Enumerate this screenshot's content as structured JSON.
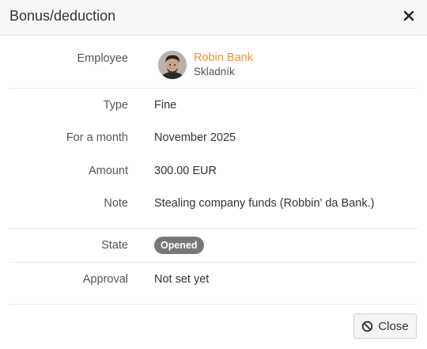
{
  "dialog": {
    "title": "Bonus/deduction",
    "close_icon": "close-icon"
  },
  "employee": {
    "label": "Employee",
    "name": "Robin Bank",
    "role": "Skladník",
    "avatar_icon": "avatar"
  },
  "fields": {
    "type": {
      "label": "Type",
      "value": "Fine"
    },
    "month": {
      "label": "For a month",
      "value": "November 2025"
    },
    "amount": {
      "label": "Amount",
      "value": "300.00 EUR"
    },
    "note": {
      "label": "Note",
      "value": "Stealing company funds (Robbin' da Bank.)"
    }
  },
  "state": {
    "label": "State",
    "badge": "Opened",
    "badge_color": "#777777"
  },
  "approval": {
    "label": "Approval",
    "value": "Not set yet"
  },
  "footer": {
    "close_label": "Close",
    "close_icon": "ban-icon"
  },
  "colors": {
    "accent": "#f0913a",
    "header_bg": "#f7f7f7"
  }
}
